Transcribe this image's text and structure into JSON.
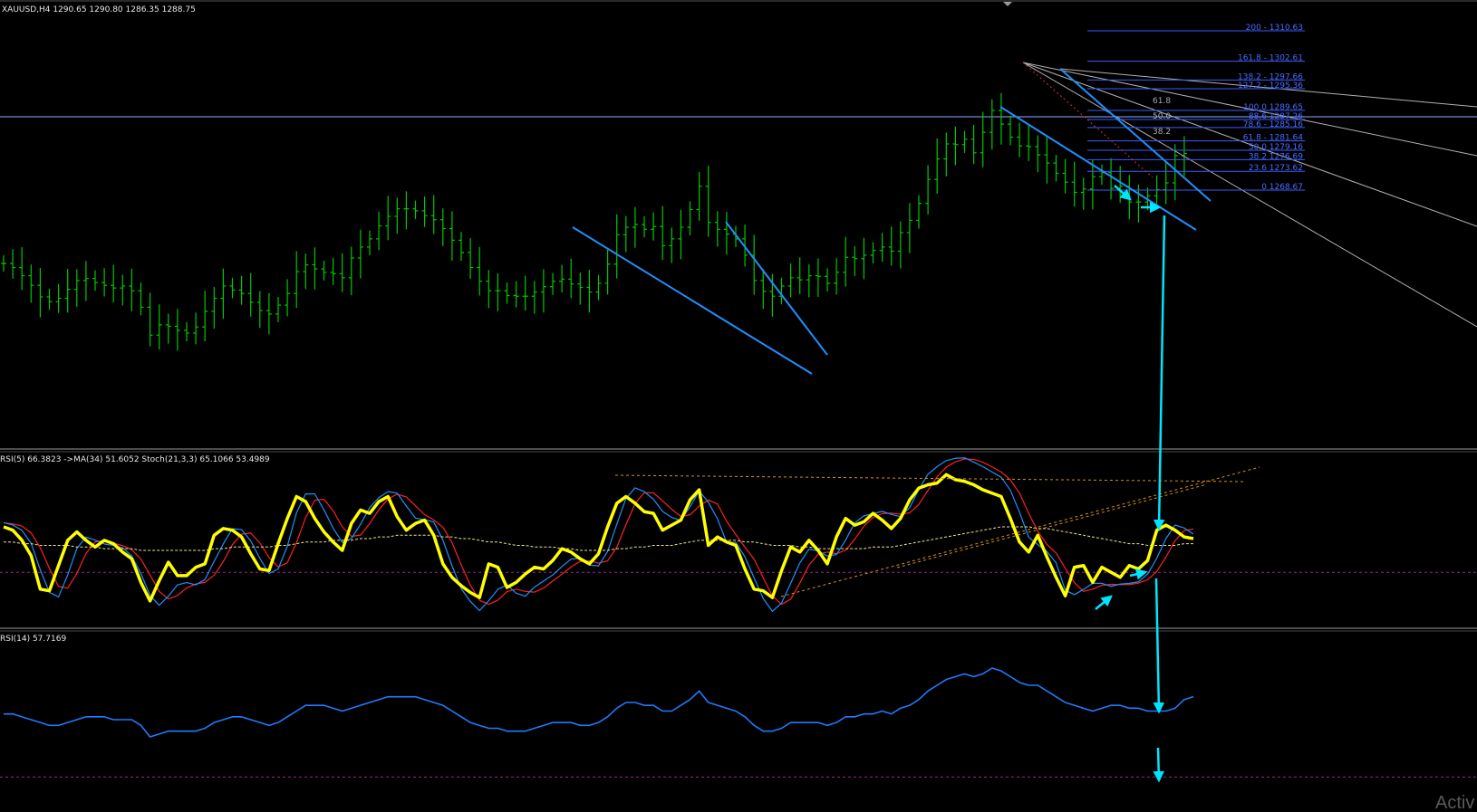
{
  "window": {
    "header": "XAUUSD,H4  1290.65 1290.80 1286.35 1288.75",
    "watermark": "Activ"
  },
  "colors": {
    "background": "#000000",
    "price_bars": "#00c800",
    "trendline": "#1e90ff",
    "fib": "#3a5bff",
    "fan": "#c0c0c0",
    "rsi5": "#ffff00",
    "ma34": "#f0e68c",
    "stoch_main": "#1e90ff",
    "stoch_signal": "#ff2020",
    "rsi14": "#1e7bff",
    "level_line": "#a020a0",
    "arrow": "#00e5ff",
    "divergence": "#d2901e"
  },
  "indicators": {
    "osc1_label": "RSI(5) 66.3823  ->MA(34) 51.6052  Stoch(21,3,3) 65.1066 53.4989",
    "osc2_label": "RSI(14) 57.7169"
  },
  "chart_data": [
    {
      "type": "ohlc",
      "symbol": "XAUUSD",
      "timeframe": "H4",
      "last": {
        "open": 1290.65,
        "high": 1290.8,
        "low": 1286.35,
        "close": 1288.75
      },
      "ylim": [
        1255,
        1312
      ],
      "closes": [
        1277.4,
        1276.8,
        1275.6,
        1274.2,
        1272.5,
        1271.8,
        1272.3,
        1273.6,
        1274.9,
        1275.2,
        1274.6,
        1274.2,
        1273.8,
        1274.1,
        1273.4,
        1271.0,
        1266.9,
        1268.4,
        1268.2,
        1267.6,
        1267.2,
        1268.1,
        1270.4,
        1272.3,
        1274.1,
        1273.5,
        1273.0,
        1271.7,
        1270.5,
        1270.0,
        1271.3,
        1273.0,
        1276.2,
        1277.2,
        1276.6,
        1276.1,
        1275.9,
        1275.3,
        1278.2,
        1279.8,
        1281.0,
        1282.9,
        1284.3,
        1285.4,
        1285.4,
        1285.1,
        1284.4,
        1283.8,
        1282.5,
        1280.8,
        1279.0,
        1276.8,
        1274.8,
        1273.4,
        1273.4,
        1272.7,
        1272.6,
        1272.6,
        1273.2,
        1274.0,
        1274.8,
        1275.1,
        1274.4,
        1273.9,
        1273.2,
        1274.5,
        1277.3,
        1281.6,
        1282.7,
        1283.1,
        1282.4,
        1282.8,
        1280.0,
        1281.0,
        1282.7,
        1285.3,
        1288.7,
        1283.4,
        1282.4,
        1281.7,
        1281.0,
        1278.6,
        1274.9,
        1273.3,
        1272.6,
        1274.1,
        1275.3,
        1275.0,
        1275.6,
        1275.5,
        1274.5,
        1276.1,
        1278.3,
        1278.1,
        1278.6,
        1279.3,
        1279.8,
        1279.2,
        1281.9,
        1283.7,
        1286.2,
        1289.7,
        1292.7,
        1294.9,
        1294.8,
        1295.6,
        1293.6,
        1296.6,
        1299.8,
        1297.8,
        1295.9,
        1294.6,
        1294.5,
        1293.3,
        1292.1,
        1290.6,
        1289.3,
        1287.8,
        1288.3,
        1290.1,
        1290.7,
        1288.4,
        1288.7,
        1286.4,
        1286.4,
        1287.3,
        1288.2,
        1289.2,
        1293.2,
        1293.5
      ]
    },
    {
      "type": "line",
      "name": "RSI(5) / MA(34) / Stoch(21,3,3)",
      "ylim": [
        0,
        100
      ],
      "levels": [
        30
      ],
      "series": [
        {
          "name": "RSI(5)",
          "values": [
            57,
            55,
            49,
            40,
            20,
            19,
            34,
            49,
            54,
            49,
            45,
            49,
            47,
            42,
            38,
            24,
            13,
            25,
            36,
            28,
            28,
            33,
            35,
            52,
            56,
            55,
            51,
            41,
            32,
            31,
            47,
            62,
            75,
            72,
            62,
            54,
            48,
            43,
            59,
            67,
            65,
            72,
            75,
            63,
            55,
            59,
            61,
            52,
            35,
            27,
            22,
            18,
            15,
            35,
            33,
            21,
            24,
            29,
            33,
            32,
            37,
            44,
            42,
            38,
            35,
            41,
            57,
            71,
            75,
            71,
            66,
            65,
            55,
            58,
            61,
            73,
            79,
            46,
            51,
            48,
            46,
            32,
            20,
            19,
            15,
            31,
            45,
            42,
            49,
            43,
            35,
            51,
            62,
            58,
            60,
            65,
            61,
            56,
            62,
            73,
            80,
            82,
            83,
            88,
            85,
            84,
            82,
            79,
            77,
            75,
            62,
            48,
            42,
            52,
            39,
            27,
            16,
            33,
            34,
            24,
            33,
            30,
            27,
            34,
            32,
            37,
            55,
            58,
            55,
            51,
            50
          ]
        },
        {
          "name": "MA(34)",
          "values": [
            48,
            48,
            47,
            47,
            46,
            46,
            46,
            46,
            45,
            45,
            45,
            44,
            44,
            44,
            44,
            43,
            43,
            43,
            43,
            43,
            43,
            43,
            43,
            44,
            44,
            45,
            45,
            45,
            45,
            45,
            46,
            46,
            47,
            48,
            48,
            48,
            49,
            49,
            49,
            50,
            50,
            51,
            51,
            52,
            52,
            52,
            52,
            52,
            51,
            51,
            50,
            50,
            49,
            48,
            48,
            47,
            46,
            46,
            45,
            45,
            45,
            44,
            44,
            43,
            43,
            43,
            43,
            44,
            44,
            45,
            45,
            46,
            46,
            46,
            47,
            48,
            49,
            49,
            49,
            49,
            49,
            48,
            48,
            47,
            46,
            46,
            46,
            45,
            45,
            44,
            44,
            44,
            44,
            44,
            44,
            45,
            45,
            45,
            46,
            47,
            48,
            49,
            50,
            51,
            52,
            53,
            54,
            55,
            56,
            57,
            57,
            57,
            57,
            56,
            56,
            55,
            54,
            53,
            52,
            51,
            50,
            49,
            48,
            47,
            47,
            46,
            46,
            46,
            46,
            47,
            47
          ]
        }
      ]
    },
    {
      "type": "line",
      "name": "RSI(14)",
      "ylim": [
        20,
        80
      ],
      "levels": [
        30
      ],
      "series": [
        {
          "name": "RSI(14)",
          "values": [
            52,
            52,
            51,
            50,
            49,
            48,
            48,
            49,
            50,
            51,
            51,
            51,
            50,
            50,
            50,
            48,
            44,
            45,
            46,
            46,
            46,
            46,
            47,
            49,
            50,
            51,
            51,
            50,
            49,
            48,
            49,
            51,
            53,
            55,
            55,
            55,
            54,
            53,
            54,
            55,
            56,
            57,
            58,
            58,
            58,
            58,
            57,
            56,
            55,
            53,
            51,
            49,
            48,
            47,
            47,
            46,
            46,
            46,
            47,
            48,
            49,
            49,
            49,
            48,
            48,
            49,
            51,
            54,
            56,
            56,
            55,
            55,
            53,
            53,
            55,
            57,
            60,
            56,
            55,
            54,
            53,
            51,
            48,
            46,
            46,
            47,
            49,
            49,
            49,
            49,
            48,
            49,
            51,
            51,
            52,
            52,
            53,
            52,
            54,
            55,
            57,
            60,
            62,
            64,
            65,
            66,
            65,
            66,
            68,
            67,
            65,
            63,
            62,
            62,
            60,
            58,
            56,
            55,
            54,
            53,
            54,
            55,
            55,
            54,
            54,
            53,
            53,
            53,
            54,
            57,
            58
          ]
        }
      ]
    }
  ]
}
